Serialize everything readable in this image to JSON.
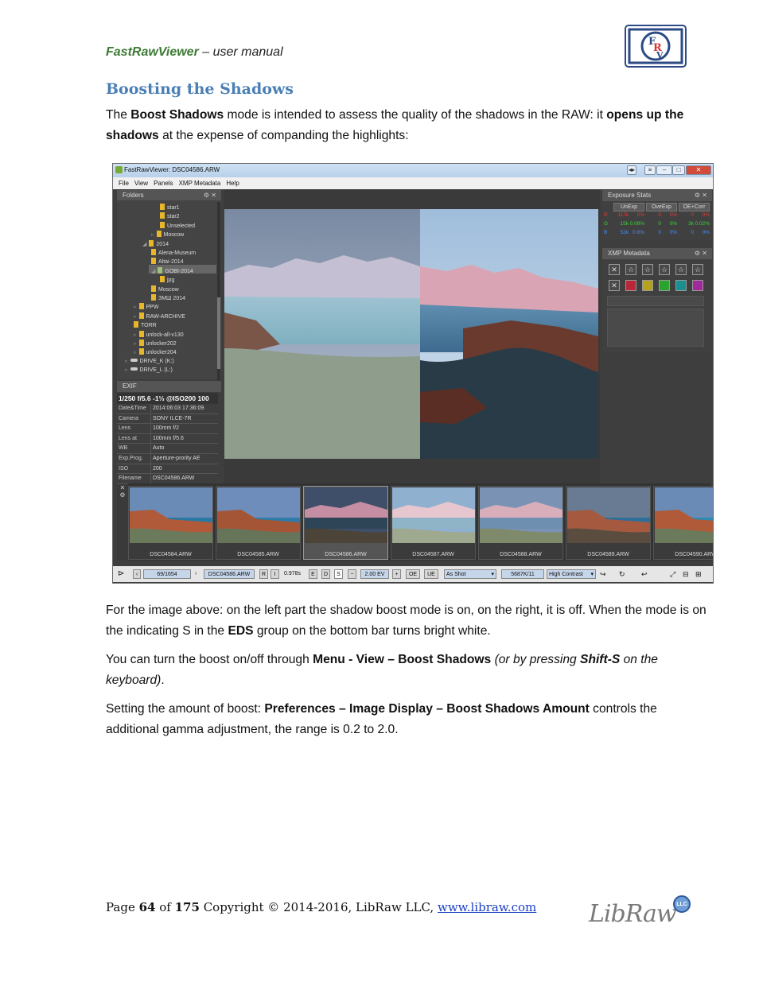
{
  "header": {
    "product": "FastRawViewer",
    "suffix": " – user manual"
  },
  "section": {
    "title": "Boosting the Shadows"
  },
  "intro": {
    "t1": "The ",
    "b1": "Boost Shadows",
    "t2": " mode is intended to assess the quality of the shadows in the RAW: it ",
    "b2": "opens up the shadows",
    "t3": " at the expense of companding the highlights:"
  },
  "screenshot": {
    "window_title": "FastRawViewer: DSC04586.ARW",
    "menu": [
      "File",
      "View",
      "Panels",
      "XMP Metadata",
      "Help"
    ],
    "folders_title": "Folders",
    "folders": [
      {
        "label": "star1",
        "indent": 3
      },
      {
        "label": "star2",
        "indent": 3
      },
      {
        "label": "Unselected",
        "indent": 3
      },
      {
        "label": "Moscow",
        "indent": 2,
        "arrow": "▹"
      },
      {
        "label": "2014",
        "indent": 1,
        "arrow": "◢"
      },
      {
        "label": "Alena-Museum",
        "indent": 2
      },
      {
        "label": "Altai-2014",
        "indent": 2
      },
      {
        "label": "GOBI-2014",
        "indent": 2,
        "arrow": "◢",
        "selected": true
      },
      {
        "label": "jpg",
        "indent": 3
      },
      {
        "label": "Moscow",
        "indent": 2
      },
      {
        "label": "ЗМШ 2014",
        "indent": 2
      },
      {
        "label": "PPW",
        "indent": 0,
        "arrow": "▹"
      },
      {
        "label": "RAW-ARCHIVE",
        "indent": 0,
        "arrow": "▹"
      },
      {
        "label": "TORR",
        "indent": 0
      },
      {
        "label": "unlock-all-v130",
        "indent": 0,
        "arrow": "▹"
      },
      {
        "label": "unlocker202",
        "indent": 0,
        "arrow": "▹"
      },
      {
        "label": "unlocker204",
        "indent": 0,
        "arrow": "▹"
      },
      {
        "label": "DRIVE_K (K:)",
        "indent": -1,
        "arrow": "▹",
        "drive": true
      },
      {
        "label": "DRIVE_L (L:)",
        "indent": -1,
        "arrow": "▹",
        "drive": true
      }
    ],
    "exif_title": "EXIF",
    "exif_summary": "1/250 f/5.6 -1⅓ @ISO200 100",
    "exif": [
      {
        "k": "Date&Time",
        "v": "2014:06:03 17:36:09"
      },
      {
        "k": "Camera",
        "v": "SONY ILCE-7R"
      },
      {
        "k": "Lens",
        "v": "100mm f/2"
      },
      {
        "k": "Lens at",
        "v": "100mm f/5.6"
      },
      {
        "k": "WB",
        "v": "Auto"
      },
      {
        "k": "Exp.Prog.",
        "v": "Aperture-prority AE"
      },
      {
        "k": "ISO",
        "v": "200"
      },
      {
        "k": "Filename",
        "v": "DSC04586.ARW"
      }
    ],
    "stats_title": "Exposure Stats",
    "stats_cols": [
      "UnExp",
      "OveExp",
      "OE+Corr"
    ],
    "stats_rows": [
      {
        "ch": "R",
        "color": "#e23b3b",
        "v": [
          "117k",
          "0%",
          "0",
          "0%",
          "0",
          "0%"
        ]
      },
      {
        "ch": "G",
        "color": "#3bd23b",
        "v": [
          "15k",
          "0.08%",
          "0",
          "0%",
          "3k",
          "0.02%"
        ]
      },
      {
        "ch": "B",
        "color": "#4b8cf0",
        "v": [
          "52k",
          "0.6%",
          "0",
          "0%",
          "0",
          "0%"
        ]
      }
    ],
    "xmp_title": "XMP Metadata",
    "thumbnails": [
      "DSC04584.ARW",
      "DSC04585.ARW",
      "DSC04586.ARW",
      "DSC04587.ARW",
      "DSC04588.ARW",
      "DSC04589.ARW",
      "DSC04590.ARW"
    ],
    "status": {
      "counter": "69/1654",
      "filename": "DSC04586.ARW",
      "r": "R",
      "i": "I",
      "time": "0.978s",
      "e": "E",
      "d": "D",
      "s": "S",
      "ev": "2.00 EV",
      "oe": "OE",
      "ue": "UE",
      "wb": "As Shot",
      "temp": "5687K/11",
      "profile": "High Contrast"
    }
  },
  "body": {
    "p1": "For the image above: on the left part the shadow boost mode is on, on the right, it is off. When the mode is on the indicating S in the ",
    "p1b": "EDS",
    "p1c": " group on the bottom bar turns bright white.",
    "p2a": "You can turn the boost on/off through ",
    "p2b": "Menu - View – Boost Shadows",
    "p2c": " (or by pressing ",
    "p2d": "Shift-S",
    "p2e": " on the keyboard)",
    "p2f": ".",
    "p3a": "Setting the amount of boost: ",
    "p3b": "Preferences – Image Display – Boost Shadows Amount",
    "p3c": " controls the additional gamma adjustment, the range is 0.2 to 2.0."
  },
  "footer": {
    "page_label": "Page ",
    "page": "64",
    "of": " of ",
    "total": "175",
    "copyright": " Copyright © 2014-2016, LibRaw LLC, ",
    "link": "www.libraw.com",
    "logo_text": "LibRaw",
    "logo_badge": "LLC"
  }
}
